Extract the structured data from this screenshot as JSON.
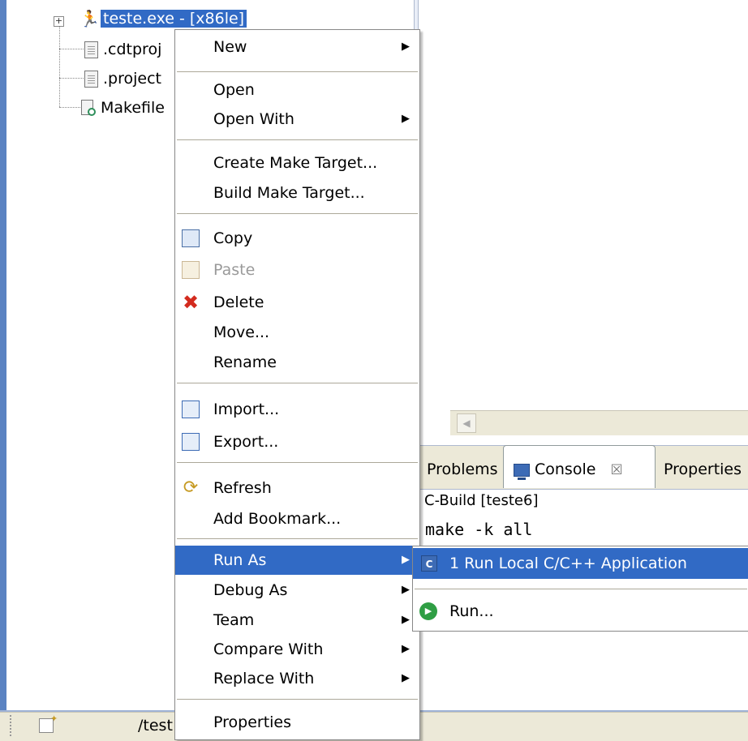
{
  "project_tree": {
    "items": [
      {
        "label": "teste.exe - [x86le]",
        "icon": "binary-run-icon",
        "selected": true
      },
      {
        "label": ".cdtproj",
        "icon": "file-icon"
      },
      {
        "label": ".project",
        "icon": "file-icon"
      },
      {
        "label": "Makefile",
        "icon": "makefile-icon"
      }
    ]
  },
  "context_menu": {
    "items": [
      {
        "label": "New",
        "submenu": true
      },
      {
        "label": "Open"
      },
      {
        "label": "Open With",
        "submenu": true
      },
      {
        "label": "Create Make Target..."
      },
      {
        "label": "Build Make Target..."
      },
      {
        "label": "Copy",
        "icon": "copy-icon"
      },
      {
        "label": "Paste",
        "icon": "paste-icon",
        "disabled": true
      },
      {
        "label": "Delete",
        "icon": "delete-icon"
      },
      {
        "label": "Move..."
      },
      {
        "label": "Rename"
      },
      {
        "label": "Import...",
        "icon": "import-icon"
      },
      {
        "label": "Export...",
        "icon": "export-icon"
      },
      {
        "label": "Refresh",
        "icon": "refresh-icon"
      },
      {
        "label": "Add Bookmark..."
      },
      {
        "label": "Run As",
        "submenu": true,
        "highlighted": true
      },
      {
        "label": "Debug As",
        "submenu": true
      },
      {
        "label": "Team",
        "submenu": true
      },
      {
        "label": "Compare With",
        "submenu": true
      },
      {
        "label": "Replace With",
        "submenu": true
      },
      {
        "label": "Properties"
      }
    ],
    "submenu_arrow": "▶"
  },
  "run_as_submenu": {
    "items": [
      {
        "label": "1 Run Local C/C++ Application",
        "icon": "c-application-icon",
        "highlighted": true
      },
      {
        "label": "Run...",
        "icon": "run-icon"
      }
    ]
  },
  "console_view": {
    "tabs": [
      {
        "label": "Problems"
      },
      {
        "label": "Console",
        "icon": "console-icon",
        "close_glyph": "☒",
        "active": true
      },
      {
        "label": "Properties"
      }
    ],
    "header": "C-Build [teste6]",
    "output": "make -k all"
  },
  "status_bar": {
    "text": "/test"
  },
  "colors": {
    "selection": "#316ac5",
    "menu_separator": "#aca899",
    "panel_bg": "#ece9d8"
  }
}
